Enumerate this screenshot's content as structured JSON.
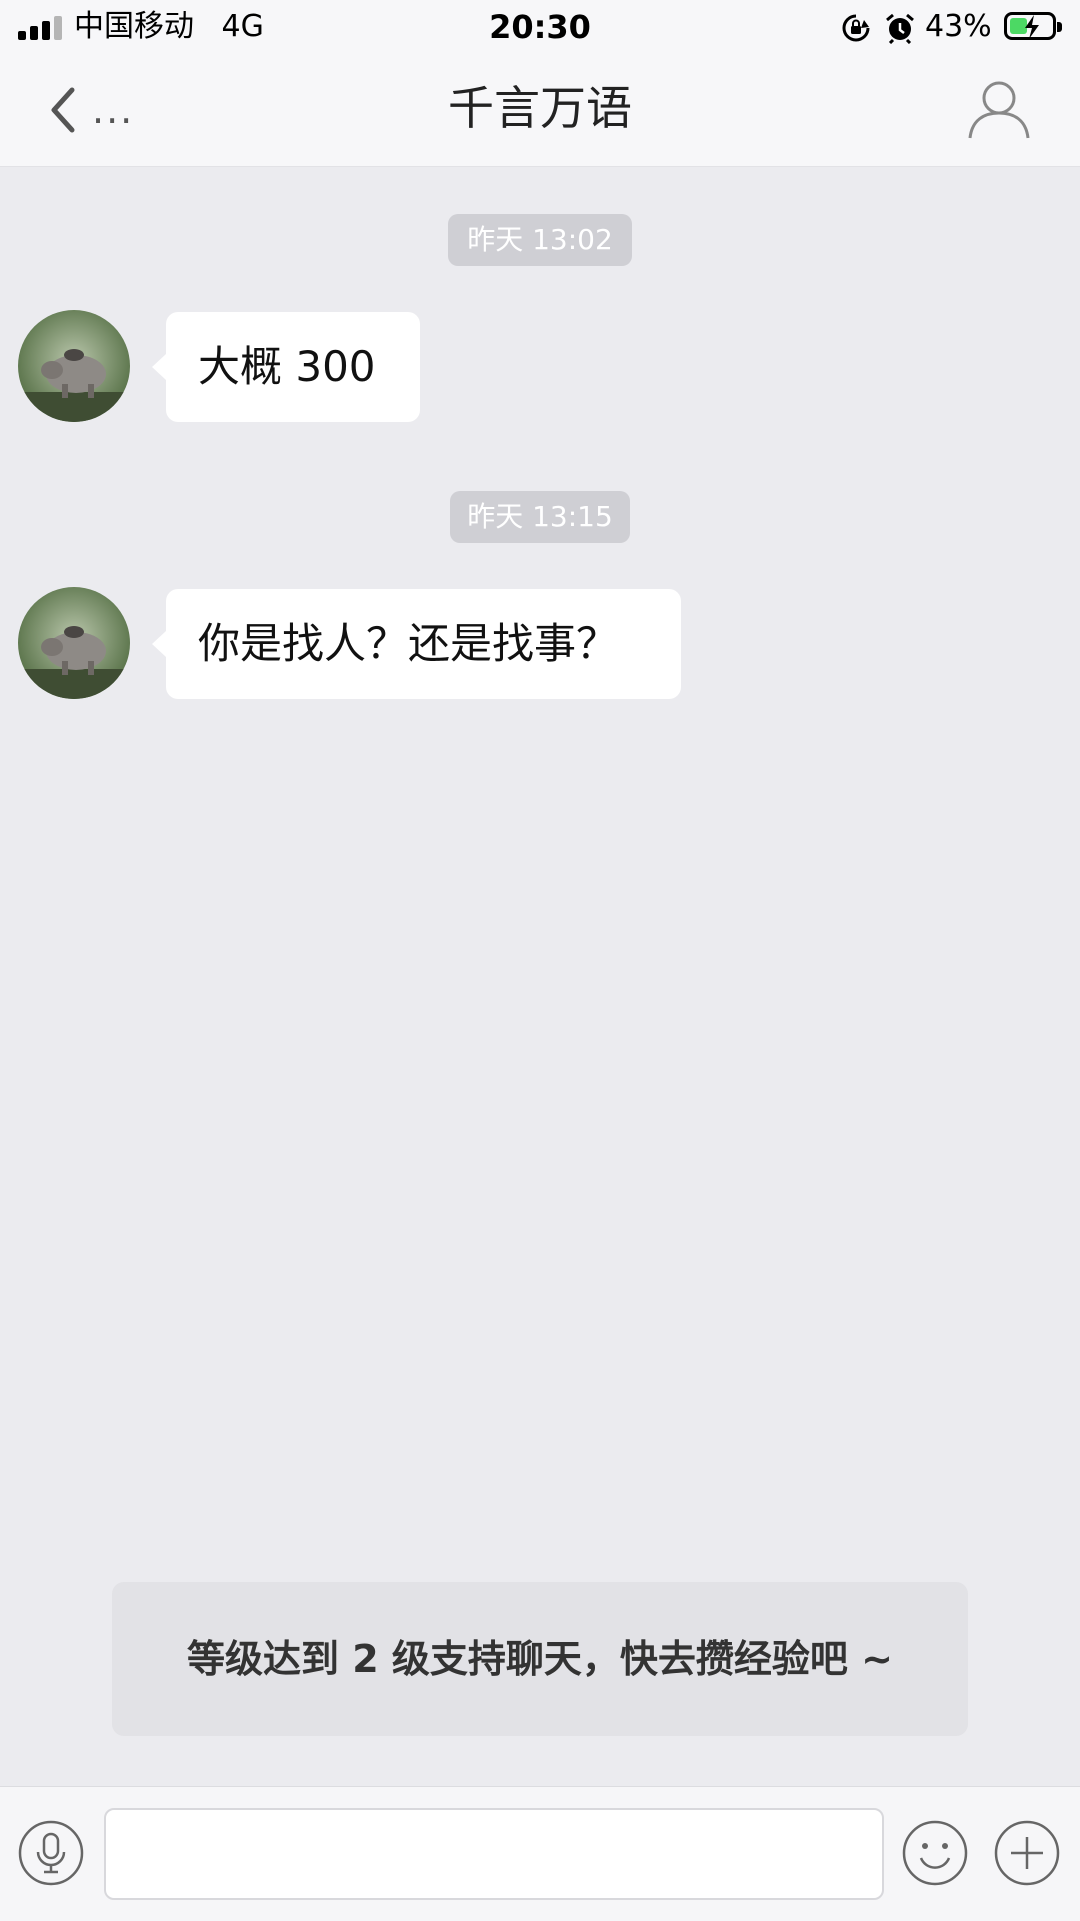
{
  "status_bar": {
    "carrier": "中国移动",
    "network": "4G",
    "time": "20:30",
    "battery_percent": "43%",
    "battery_level": 0.43,
    "icons": [
      "signal-icon",
      "rotation-lock-icon",
      "alarm-icon",
      "battery-charging-icon"
    ]
  },
  "nav": {
    "back_icon": "chevron-left-icon",
    "back_label": "...",
    "title": "千言万语",
    "profile_icon": "person-icon"
  },
  "messages": [
    {
      "timestamp": "昨天 13:02",
      "text": "大概 300"
    },
    {
      "timestamp": "昨天 13:15",
      "text": "你是找人？还是找事？"
    }
  ],
  "notice": "等级达到 2 级支持聊天，快去攒经验吧 ~",
  "input_bar": {
    "placeholder": "",
    "voice_icon": "microphone-icon",
    "emoji_icon": "smiley-icon",
    "more_icon": "plus-icon"
  },
  "colors": {
    "background": "#ebebef",
    "bubble": "#ffffff",
    "timestamp_bg": "#cfcfd4",
    "battery_green": "#4cd964"
  }
}
